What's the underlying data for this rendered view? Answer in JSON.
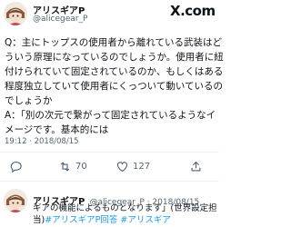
{
  "main_tweet": {
    "display_name": "アリスギアP",
    "handle": "@alicegear_P",
    "platform_logo": "X.com",
    "body_lines": [
      "Q：主にトップスの使用者から離れている武装はど",
      "ういう原理になっているのでしょうか。使用者に紐",
      "付けられていて固定されているのか、もしくはある",
      "程度独立していて使用者にくっついて動いているの",
      "でしょうか",
      "A：「別の次元で繋がって固定されているようなイ",
      "メージです。基本的には"
    ],
    "timestamp": "19:12 · 2018/08/15",
    "actions": {
      "retweet_count": "70",
      "like_count": "127"
    }
  },
  "reply_tweet": {
    "display_name": "アリスギアP",
    "handle_and_date": "@alicegear_P · 2018/08/15",
    "line1": "ギアの機能によるものとなります」(世界設定担",
    "line2_prefix": "当)",
    "hashtags": "#アリスギアP回答 #アリスギア"
  },
  "icons": [
    "avatar",
    "x-logo",
    "reply-icon",
    "retweet-icon",
    "like-icon",
    "share-icon"
  ],
  "colors": {
    "hashtag": "#1d9bf0",
    "muted": "#536471",
    "text": "#0f1419"
  }
}
